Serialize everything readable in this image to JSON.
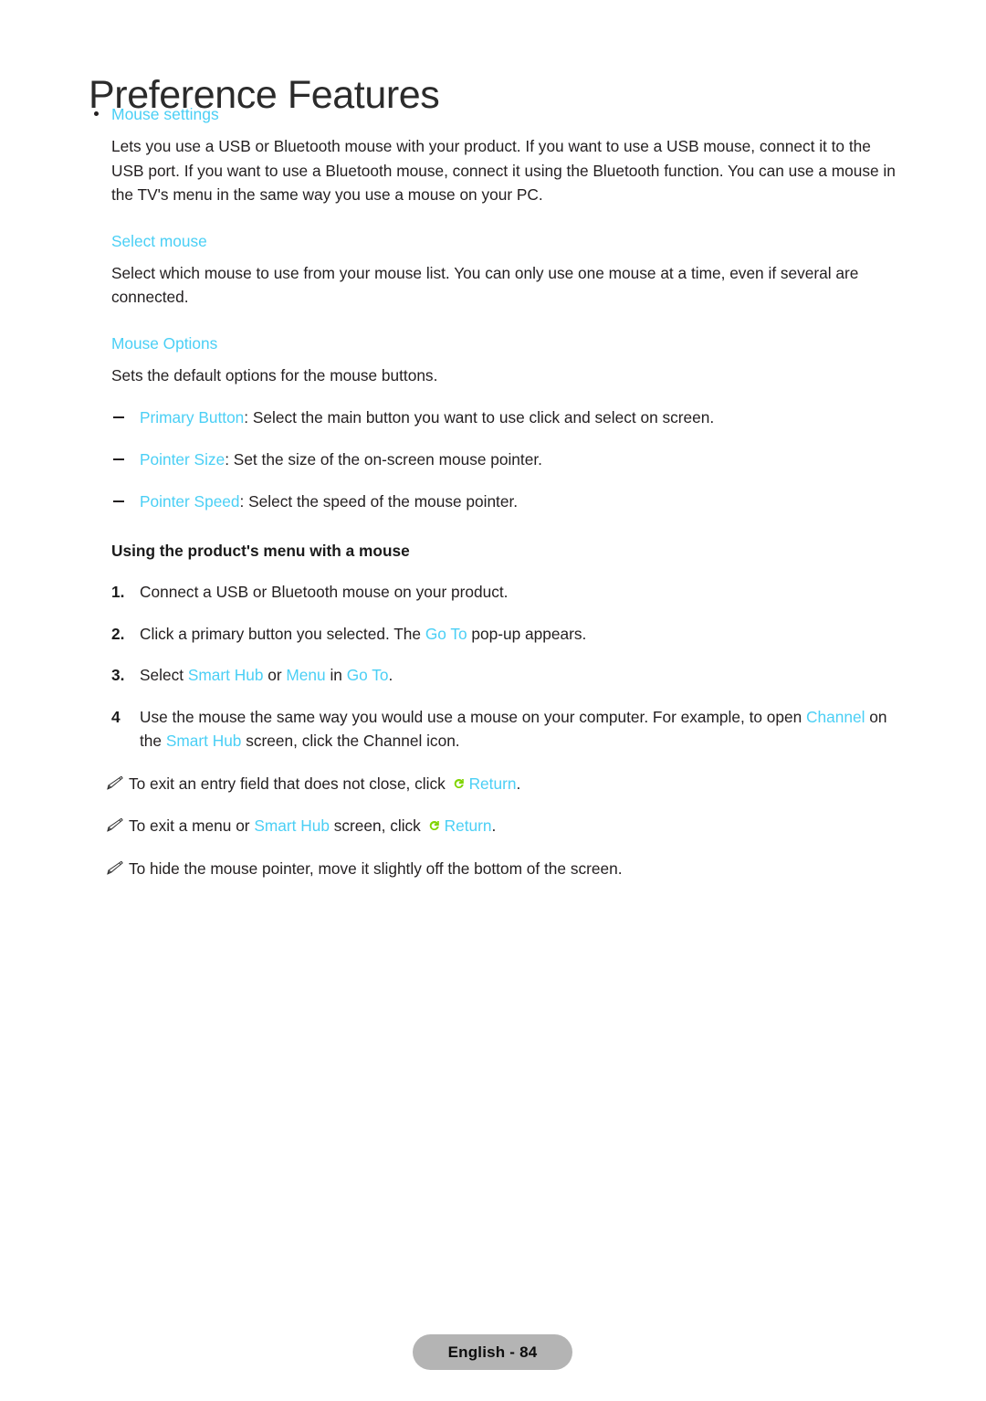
{
  "page": {
    "title": "Preference Features",
    "footer_label": "English - 84"
  },
  "colors": {
    "accent_cyan": "#4ACFF5",
    "return_icon_green": "#7FD400",
    "body_text": "#231f20",
    "footer_pill_bg": "#b4b4b4"
  },
  "sections": {
    "mouse_settings": {
      "heading": "Mouse settings",
      "paragraph": "Lets you use a USB or Bluetooth mouse with your product. If you want to use a USB mouse, connect it to the USB port. If you want to use a Bluetooth mouse, connect it using the Bluetooth function. You can use a mouse in the TV's menu in the same way you use a mouse on your PC."
    },
    "select_mouse": {
      "heading": "Select mouse",
      "paragraph": "Select which mouse to use from your mouse list. You can only use one mouse at a time, even if several are connected."
    },
    "mouse_options": {
      "heading": "Mouse Options",
      "paragraph": "Sets the default options for the mouse buttons.",
      "items": [
        {
          "term": "Primary Button",
          "desc": ": Select the main button you want to use click and select on screen."
        },
        {
          "term": "Pointer Size",
          "desc": ": Set the size of the on-screen mouse pointer."
        },
        {
          "term": "Pointer Speed",
          "desc": ": Select the speed of the mouse pointer."
        }
      ]
    },
    "using_menu": {
      "heading": "Using the product's menu with a mouse",
      "steps": [
        {
          "num": "1.",
          "parts": [
            {
              "t": "Connect a USB or Bluetooth mouse on your product.",
              "c": "black"
            }
          ]
        },
        {
          "num": "2.",
          "parts": [
            {
              "t": "Click a primary button you selected. The ",
              "c": "black"
            },
            {
              "t": "Go To",
              "c": "cyan"
            },
            {
              "t": " pop-up appears.",
              "c": "black"
            }
          ]
        },
        {
          "num": "3.",
          "parts": [
            {
              "t": "Select ",
              "c": "black"
            },
            {
              "t": "Smart Hub",
              "c": "cyan"
            },
            {
              "t": " or ",
              "c": "black"
            },
            {
              "t": "Menu",
              "c": "cyan"
            },
            {
              "t": " in ",
              "c": "black"
            },
            {
              "t": "Go To",
              "c": "cyan"
            },
            {
              "t": ".",
              "c": "black"
            }
          ]
        },
        {
          "num": "4",
          "parts": [
            {
              "t": "Use the mouse the same way you would use a mouse on your computer. For example, to open ",
              "c": "black"
            },
            {
              "t": "Channel",
              "c": "cyan"
            },
            {
              "t": " on the ",
              "c": "black"
            },
            {
              "t": "Smart Hub",
              "c": "cyan"
            },
            {
              "t": " screen, click the Channel icon.",
              "c": "black"
            }
          ]
        }
      ],
      "notes": [
        {
          "parts": [
            {
              "t": "To exit an entry field that does not close, click ",
              "c": "black"
            },
            {
              "t": "RETURN_ICON",
              "c": "icon"
            },
            {
              "t": "Return",
              "c": "cyan"
            },
            {
              "t": ".",
              "c": "black"
            }
          ]
        },
        {
          "parts": [
            {
              "t": "To exit a menu or ",
              "c": "black"
            },
            {
              "t": "Smart Hub",
              "c": "cyan"
            },
            {
              "t": " screen, click ",
              "c": "black"
            },
            {
              "t": "RETURN_ICON",
              "c": "icon"
            },
            {
              "t": "Return",
              "c": "cyan"
            },
            {
              "t": ".",
              "c": "black"
            }
          ]
        },
        {
          "parts": [
            {
              "t": "To hide the mouse pointer, move it slightly off the bottom of the screen.",
              "c": "black"
            }
          ]
        }
      ]
    }
  }
}
